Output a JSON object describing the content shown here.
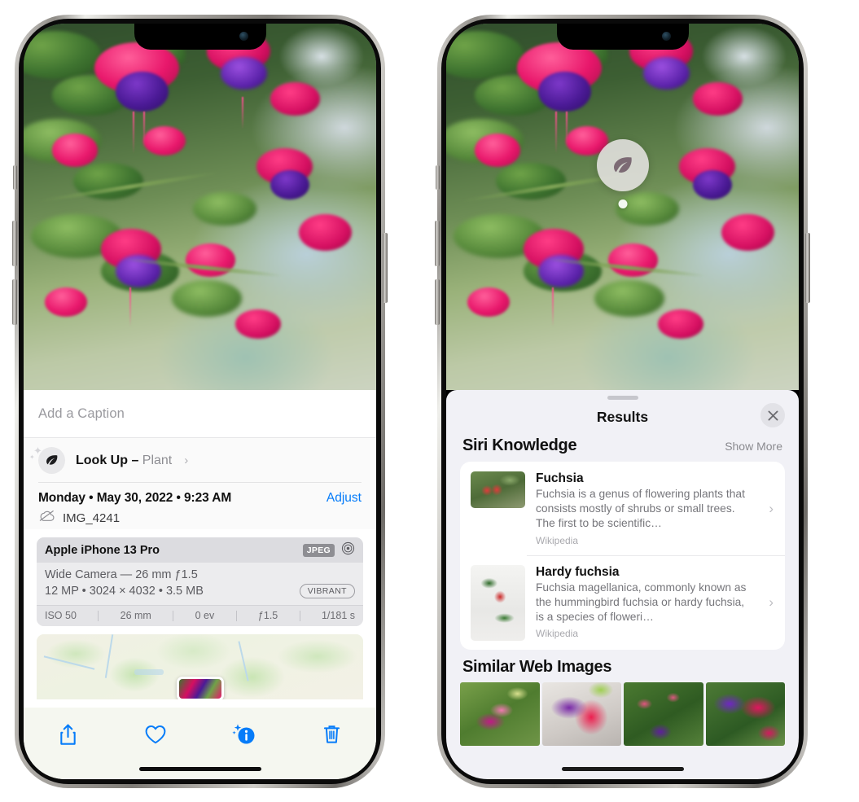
{
  "left_phone": {
    "caption": {
      "placeholder": "Add a Caption",
      "value": ""
    },
    "lookup": {
      "label": "Look Up – ",
      "subject": "Plant",
      "chevron": "›",
      "icon": "leaf-icon"
    },
    "meta": {
      "date_line": "Monday • May 30, 2022 • 9:23 AM",
      "adjust_label": "Adjust",
      "filename": "IMG_4241",
      "cloud_icon": "cloud-slash-icon"
    },
    "camera_card": {
      "model": "Apple iPhone 13 Pro",
      "format_badge": "JPEG",
      "lens_icon": "aperture-icon",
      "lens_line": "Wide Camera — 26 mm ƒ1.5",
      "specs_line": "12 MP • 3024 × 4032 • 3.5 MB",
      "style_badge": "VIBRANT",
      "exif": [
        "ISO 50",
        "26 mm",
        "0 ev",
        "ƒ1.5",
        "1/181 s"
      ]
    },
    "map": {
      "pin_icon": "photo-pin"
    },
    "toolbar": [
      {
        "name": "share-button",
        "icon": "share-icon"
      },
      {
        "name": "favorite-button",
        "icon": "heart-icon"
      },
      {
        "name": "info-button",
        "icon": "info-sparkle-icon"
      },
      {
        "name": "delete-button",
        "icon": "trash-icon"
      }
    ],
    "accent_color": "#067cf9"
  },
  "right_phone": {
    "photo_badge": {
      "icon": "leaf-icon"
    },
    "sheet": {
      "title": "Results",
      "close_icon": "close-icon",
      "grabber": "drag-handle"
    },
    "siri_knowledge": {
      "section_title": "Siri Knowledge",
      "show_more": "Show More",
      "items": [
        {
          "title": "Fuchsia",
          "description": "Fuchsia is a genus of flowering plants that consists mostly of shrubs or small trees. The first to be scientific…",
          "source": "Wikipedia",
          "thumb": "fuchsia-red-flowers",
          "chevron": "›"
        },
        {
          "title": "Hardy fuchsia",
          "description": "Fuchsia magellanica, commonly known as the hummingbird fuchsia or hardy fuchsia, is a species of floweri…",
          "source": "Wikipedia",
          "thumb": "hardy-fuchsia-specimen",
          "chevron": "›"
        }
      ]
    },
    "similar_web_images": {
      "section_title": "Similar Web Images",
      "thumbs": [
        {
          "name": "web-image-1"
        },
        {
          "name": "web-image-2"
        },
        {
          "name": "web-image-3"
        },
        {
          "name": "web-image-4"
        }
      ]
    }
  }
}
